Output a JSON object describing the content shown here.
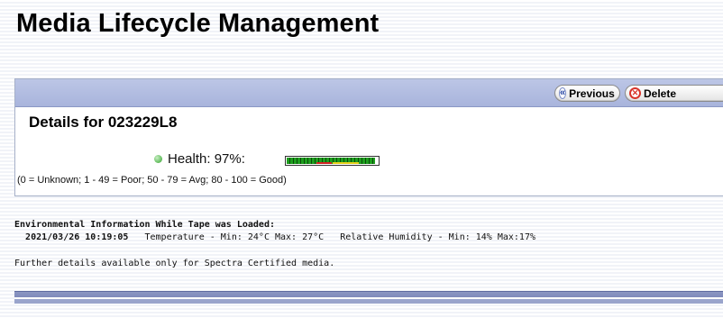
{
  "page": {
    "title": "Media Lifecycle Management"
  },
  "toolbar": {
    "previous_label": "Previous",
    "delete_label": "Delete",
    "previous_icon": "chevron-left-double-icon",
    "delete_icon": "delete-icon"
  },
  "details": {
    "heading": "Details for 023229L8",
    "health_label": "Health: 97%:",
    "health_percent": 97,
    "health_scale": "(0 = Unknown; 1 - 49 = Poor; 50 - 79 = Avg; 80 - 100 = Good)"
  },
  "environment": {
    "heading": "Environmental Information While Tape was Loaded:",
    "timestamp": "2021/03/26 10:19:05",
    "temperature": "Temperature - Min: 24°C Max: 27°C",
    "humidity": "Relative Humidity - Min: 14% Max:17%",
    "note": "Further details available only for Spectra Certified media."
  },
  "colors": {
    "header_band": "#a8b4dc",
    "health_good": "#1d9e1d",
    "health_poor": "#d32222",
    "health_avg": "#e5d01a",
    "delete_accent": "#d9352b"
  }
}
